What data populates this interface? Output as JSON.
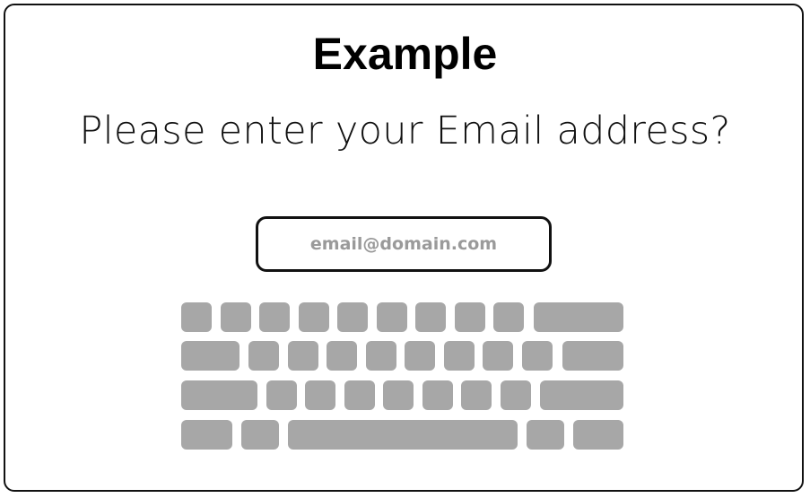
{
  "title": "Example",
  "prompt": "Please enter your Email address?",
  "email_field": {
    "value": "",
    "placeholder": "email@domain.com"
  },
  "keyboard": {
    "key_color": "#a7a7a7",
    "rows": [
      {
        "keys": 10
      },
      {
        "keys": 10
      },
      {
        "keys": 9
      },
      {
        "keys": 5
      }
    ]
  }
}
